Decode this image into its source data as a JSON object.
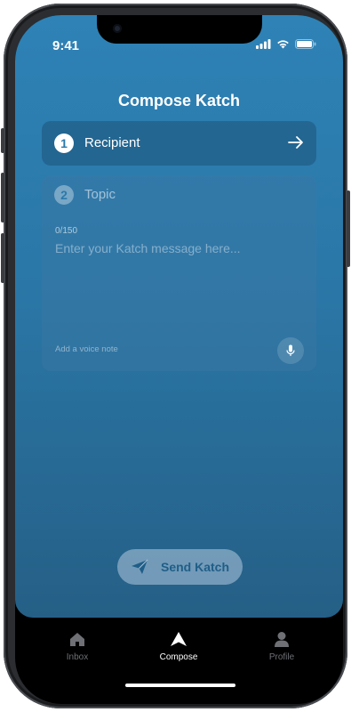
{
  "status_bar": {
    "time": "9:41"
  },
  "header": {
    "title": "Compose Katch"
  },
  "recipient_card": {
    "step": "1",
    "label": "Recipient"
  },
  "topic_card": {
    "step": "2",
    "label": "Topic",
    "counter": "0/150",
    "message_placeholder": "Enter your Katch message here...",
    "message_value": "",
    "voice_note_label": "Add a voice note"
  },
  "send_button": {
    "label": "Send Katch"
  },
  "tabbar": {
    "tabs": [
      {
        "label": "Inbox",
        "icon": "home-icon",
        "active": false
      },
      {
        "label": "Compose",
        "icon": "compose-icon",
        "active": true
      },
      {
        "label": "Profile",
        "icon": "person-icon",
        "active": false
      }
    ]
  },
  "colors": {
    "accent": "#2a79ab",
    "background_top": "#2e82b6",
    "background_bottom": "#255f86"
  }
}
